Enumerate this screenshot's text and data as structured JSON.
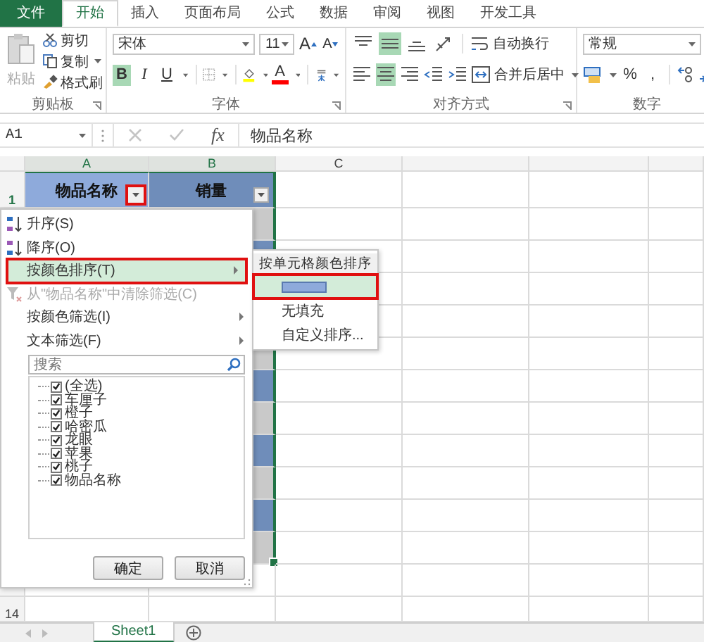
{
  "ribbon_tabs": [
    {
      "label": "文件",
      "kind": "file",
      "selected": false
    },
    {
      "label": "开始",
      "kind": "tab",
      "selected": true
    },
    {
      "label": "插入",
      "kind": "tab",
      "selected": false
    },
    {
      "label": "页面布局",
      "kind": "tab",
      "selected": false
    },
    {
      "label": "公式",
      "kind": "tab",
      "selected": false
    },
    {
      "label": "数据",
      "kind": "tab",
      "selected": false
    },
    {
      "label": "审阅",
      "kind": "tab",
      "selected": false
    },
    {
      "label": "视图",
      "kind": "tab",
      "selected": false
    },
    {
      "label": "开发工具",
      "kind": "tab",
      "selected": false
    }
  ],
  "clipboard": {
    "paste": "粘贴",
    "cut": "剪切",
    "copy": "复制",
    "format_painter": "格式刷",
    "label": "剪贴板"
  },
  "font": {
    "name": "宋体",
    "size": "11",
    "grow": "A",
    "shrink": "A",
    "color_letter": "A",
    "label": "字体",
    "style_buttons": [
      {
        "label": "B",
        "kind": "bold",
        "selected": true
      },
      {
        "label": "I",
        "kind": "italic",
        "selected": false
      },
      {
        "label": "U",
        "kind": "underline",
        "selected": false
      }
    ]
  },
  "alignment": {
    "label": "对齐方式",
    "wrap": "自动换行",
    "merge": "合并后居中",
    "top_row": [
      {
        "kind": "top",
        "selected": false
      },
      {
        "kind": "middle",
        "selected": true
      },
      {
        "kind": "bottom",
        "selected": false
      },
      {
        "kind": "orientation",
        "selected": false
      }
    ],
    "bottom_row": [
      {
        "kind": "left",
        "selected": false
      },
      {
        "kind": "center",
        "selected": true
      },
      {
        "kind": "right",
        "selected": false
      },
      {
        "kind": "outdent",
        "selected": false
      },
      {
        "kind": "indent",
        "selected": false
      }
    ]
  },
  "number": {
    "format": "常规",
    "percent": "%",
    "comma": ",",
    "label": "数字"
  },
  "formula_bar": {
    "name_box": "A1",
    "fx": "fx",
    "value": "物品名称"
  },
  "sheet": {
    "columns": [
      {
        "label": "A",
        "selected": true
      },
      {
        "label": "B",
        "selected": true
      },
      {
        "label": "C",
        "selected": false
      }
    ],
    "header_row": {
      "number": "1",
      "cells": [
        {
          "text": "物品名称",
          "color": "#8eaadb",
          "annotated": true
        },
        {
          "text": "销量",
          "color": "#6f8dba",
          "annotated": false
        }
      ]
    },
    "band_rows_above_submenu": [
      {
        "color": "#c9c9c9"
      },
      {
        "color": "#6f8dba"
      }
    ],
    "band_rows_below_submenu": [
      {
        "color": "#c9c9c9"
      },
      {
        "color": "#6f8dba"
      },
      {
        "color": "#c9c9c9"
      },
      {
        "color": "#6f8dba"
      },
      {
        "color": "#c9c9c9"
      },
      {
        "color": "#6f8dba"
      },
      {
        "color": "#c9c9c9"
      }
    ],
    "last_row_number": "14"
  },
  "filter_menu": {
    "items": [
      {
        "label": "升序(S)",
        "kind": "sort_asc",
        "disabled": false,
        "selected": false,
        "submenu": false,
        "annotated": false
      },
      {
        "label": "降序(O)",
        "kind": "sort_desc",
        "disabled": false,
        "selected": false,
        "submenu": false,
        "annotated": false
      },
      {
        "label": "按颜色排序(T)",
        "kind": "plain",
        "disabled": false,
        "selected": true,
        "submenu": true,
        "annotated": true
      },
      {
        "label": "从\"物品名称\"中清除筛选(C)",
        "kind": "clear_filter",
        "disabled": true,
        "selected": false,
        "submenu": false,
        "annotated": false
      },
      {
        "label": "按颜色筛选(I)",
        "kind": "plain",
        "disabled": false,
        "selected": false,
        "submenu": true,
        "annotated": false
      },
      {
        "label": "文本筛选(F)",
        "kind": "plain",
        "disabled": false,
        "selected": false,
        "submenu": true,
        "annotated": false
      }
    ],
    "search_placeholder": "搜索",
    "values": [
      {
        "label": "(全选)",
        "checked": true
      },
      {
        "label": "车厘子",
        "checked": true
      },
      {
        "label": "橙子",
        "checked": true
      },
      {
        "label": "哈密瓜",
        "checked": true
      },
      {
        "label": "龙眼",
        "checked": true
      },
      {
        "label": "苹果",
        "checked": true
      },
      {
        "label": "桃子",
        "checked": true
      },
      {
        "label": "物品名称",
        "checked": true
      }
    ],
    "buttons": [
      "确定",
      "取消"
    ]
  },
  "color_submenu": {
    "title": "按单元格颜色排序",
    "items": [
      {
        "kind": "swatch",
        "color": "#8eaadb",
        "selected": true,
        "annotated": true
      },
      {
        "kind": "text",
        "label": "无填充",
        "selected": false,
        "annotated": false
      },
      {
        "kind": "text",
        "label": "自定义排序...",
        "selected": false,
        "annotated": false
      }
    ]
  },
  "sheet_tabs": [
    {
      "label": "Sheet1",
      "selected": true
    }
  ]
}
